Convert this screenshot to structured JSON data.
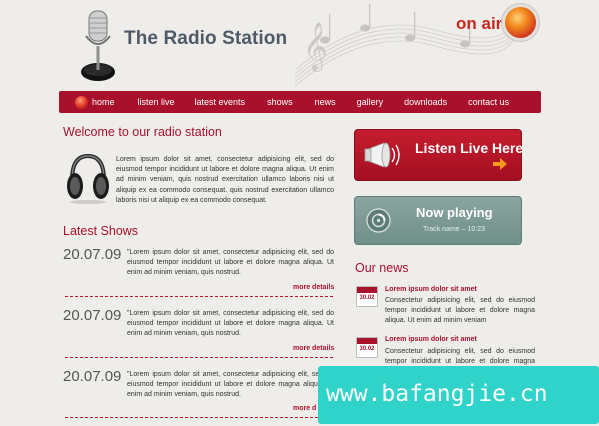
{
  "header": {
    "title": "The Radio Station",
    "on_air": "on air"
  },
  "nav": {
    "items": [
      "home",
      "listen live",
      "latest events",
      "shows",
      "news",
      "gallery",
      "downloads",
      "contact us"
    ]
  },
  "welcome": {
    "title": "Welcome to our radio station",
    "text": "Lorem ipsum dolor sit amet, consectetur adipisicing elit, sed do eiusmod tempor incididunt ut labore et dolore magna aliqua. Ut enim ad minim veniam, quis nostrud exercitation ullamco laboris nisi ut aliquip ex ea commodo consequat. quis nostrud exercitation ullamco laboris nisi ut aliquip ex ea commodo consequat."
  },
  "shows": {
    "title": "Latest Shows",
    "items": [
      {
        "date": "20.07.09",
        "text": "\"Lorem ipsum dolor sit amet, consectetur adipisicing elit, sed do eiusmod tempor incididunt ut labore et dolore magna aliqua. Ut enim ad minim veniam, quis nostrud.",
        "more": "more details"
      },
      {
        "date": "20.07.09",
        "text": "\"Lorem ipsum dolor sit amet, consectetur adipisicing elit, sed do eiusmod tempor incididunt ut labore et dolore magna aliqua. Ut enim ad minim veniam, quis nostrud.",
        "more": "more details"
      },
      {
        "date": "20.07.09",
        "text": "\"Lorem ipsum dolor sit amet, consectetur adipisicing elit, sed do eiusmod tempor incididunt ut labore et dolore magna aliqua. Ut enim ad minim veniam, quis nostrud.",
        "more": "more d"
      }
    ]
  },
  "listen_live": {
    "label": "Listen Live Here"
  },
  "now_playing": {
    "label": "Now playing",
    "track": "Track name – 10:23"
  },
  "news": {
    "title": "Our news",
    "items": [
      {
        "day": "30.02",
        "headline": "Lorem ipsum dolor sit amet",
        "text": "Consectetur adipisicing elit, sed do eiusmod tempor incididunt ut labore et dolore magna aliqua. Ut enim ad minim veniam"
      },
      {
        "day": "30.02",
        "headline": "Lorem ipsum dolor sit amet",
        "text": "Consectetur adipisicing elit, sed do eiusmod tempor incididunt ut labore et dolore magna aliqua. Ut enim ad minim veniam"
      }
    ]
  },
  "watermark": "www.bafangjie.cn",
  "colors": {
    "accent": "#a8102c",
    "background": "#eeedea",
    "now_playing": "#7c9892",
    "watermark": "#2fd3c9"
  },
  "icons": [
    "microphone-icon",
    "music-notes-decoration",
    "on-air-lamp-icon",
    "home-icon",
    "headphones-icon",
    "megaphone-icon",
    "arrow-right-icon",
    "disc-icon",
    "calendar-icon"
  ]
}
